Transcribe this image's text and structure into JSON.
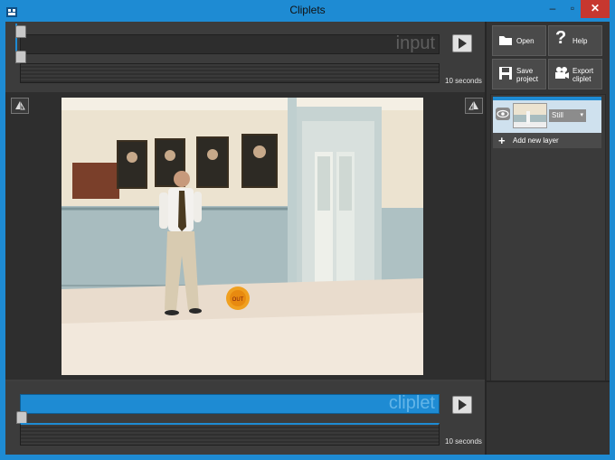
{
  "window": {
    "title": "Cliplets",
    "minimize": "–",
    "maximize": "▫",
    "close": "✕"
  },
  "input_timeline": {
    "label": "input",
    "duration": "10 seconds",
    "position": 0
  },
  "output_timeline": {
    "label": "cliplet",
    "duration": "10 seconds",
    "position": 0
  },
  "toolbar": {
    "open": "Open",
    "help": "Help",
    "save_project": [
      "Save",
      "project"
    ],
    "export_cliplet": [
      "Export",
      "cliplet"
    ]
  },
  "layers": [
    {
      "type": "Still",
      "visible": true
    }
  ],
  "add_layer_label": "Add new layer",
  "icons": [
    "app-icon",
    "folder-icon",
    "question-icon",
    "save-icon",
    "video-camera-icon",
    "eye-icon",
    "plus-icon",
    "play-icon",
    "flip-left-icon",
    "flip-right-icon"
  ],
  "colors": {
    "accent": "#1e8bd3",
    "panel": "#3c3c3c",
    "close": "#c7372f"
  }
}
